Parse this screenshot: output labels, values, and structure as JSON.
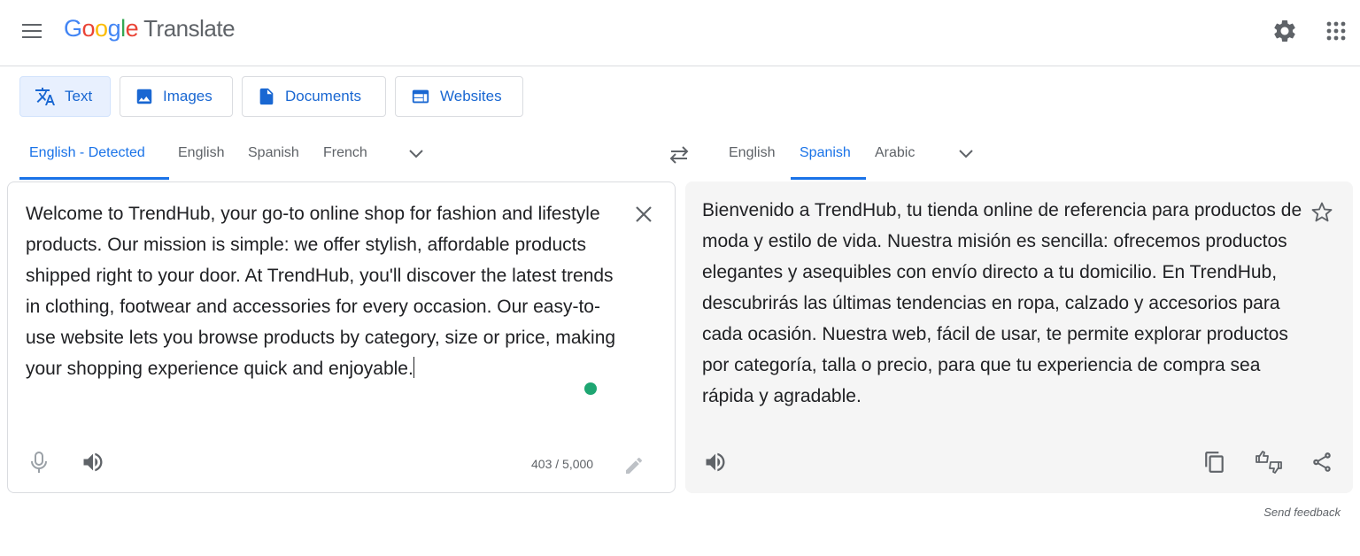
{
  "header": {
    "logo_letters": [
      "G",
      "o",
      "o",
      "g",
      "l",
      "e"
    ],
    "product_name": "Translate",
    "icons": [
      "menu-icon",
      "settings-gear-icon",
      "apps-grid-icon"
    ]
  },
  "mode_tabs": [
    {
      "label": "Text",
      "icon": "translate-icon",
      "active": true
    },
    {
      "label": "Images",
      "icon": "image-icon",
      "active": false
    },
    {
      "label": "Documents",
      "icon": "document-icon",
      "active": false
    },
    {
      "label": "Websites",
      "icon": "website-icon",
      "active": false
    }
  ],
  "source_langs": {
    "tabs": [
      "English - Detected",
      "English",
      "Spanish",
      "French"
    ],
    "active_index": 0
  },
  "target_langs": {
    "tabs": [
      "English",
      "Spanish",
      "Arabic"
    ],
    "active_index": 1
  },
  "source": {
    "text": "Welcome to TrendHub, your go-to online shop for fashion and lifestyle products. Our mission is simple: we offer stylish, affordable products shipped right to your door. At TrendHub, you'll discover the latest trends in clothing, footwear and accessories for every occasion. Our easy-to-use website lets you browse products by category, size or price, making your shopping experience quick and enjoyable.",
    "char_count": "403 / 5,000"
  },
  "target": {
    "text": "Bienvenido a TrendHub, tu tienda online de referencia para productos de moda y estilo de vida. Nuestra misión es sencilla: ofrecemos productos elegantes y asequibles con envío directo a tu domicilio. En TrendHub, descubrirás las últimas tendencias en ropa, calzado y accesorios para cada ocasión. Nuestra web, fácil de usar, te permite explorar productos por categoría, talla o precio, para que tu experiencia de compra sea rápida y agradable."
  },
  "footer": {
    "send_feedback": "Send feedback"
  },
  "colors": {
    "accent": "#1a73e8",
    "active_tab_bg": "#e8f0fe",
    "target_panel_bg": "#f5f5f5",
    "grammar_dot": "#1ea672"
  }
}
